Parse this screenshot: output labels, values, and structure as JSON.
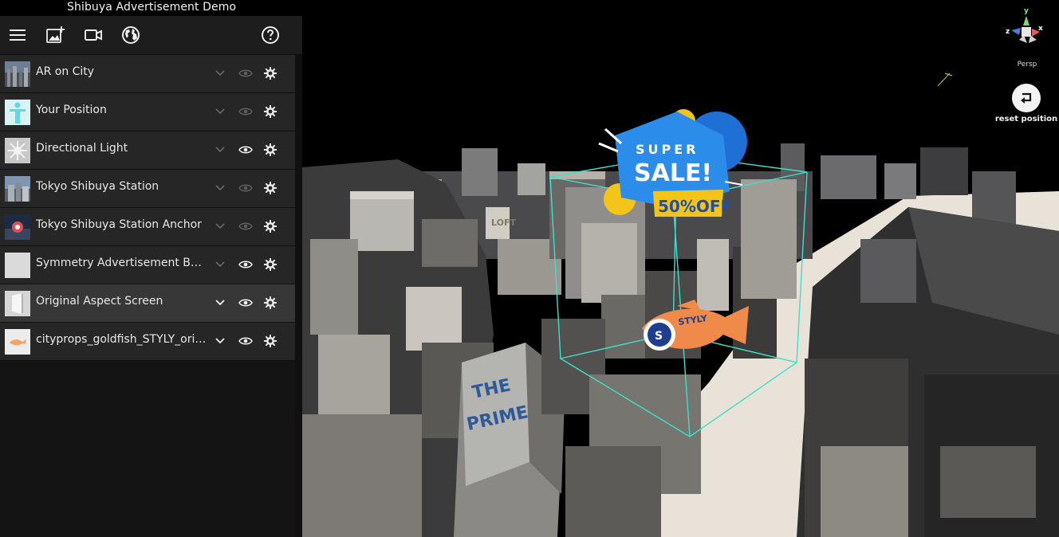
{
  "app": {
    "title": "Shibuya Advertisement Demo"
  },
  "toolbar": {
    "icons": [
      "menu-icon",
      "add-image-icon",
      "video-icon",
      "globe-icon",
      "help-icon"
    ]
  },
  "layers": [
    {
      "name": "AR on City",
      "visible": false,
      "expanded": false,
      "selected": false
    },
    {
      "name": "Your Position",
      "visible": false,
      "expanded": false,
      "selected": false
    },
    {
      "name": "Directional Light",
      "visible": true,
      "expanded": false,
      "selected": false
    },
    {
      "name": "Tokyo Shibuya Station",
      "visible": false,
      "expanded": false,
      "selected": false
    },
    {
      "name": "Tokyo Shibuya Station Anchor",
      "visible": false,
      "expanded": false,
      "selected": false
    },
    {
      "name": "Symmetry Advertisement Boundary",
      "visible": true,
      "expanded": false,
      "selected": false
    },
    {
      "name": "Original Aspect Screen",
      "visible": true,
      "expanded": true,
      "selected": true
    },
    {
      "name": "cityprops_goldfish_STYLY_original",
      "visible": true,
      "expanded": true,
      "selected": false
    }
  ],
  "viewport": {
    "gizmo": {
      "axis_y": "y",
      "axis_z": "z",
      "axis_x": "x",
      "projection": "Persp"
    },
    "reset_label": "reset position",
    "billboard": {
      "line1": "SUPER",
      "line2": "SALE!",
      "line3": "50%OFF"
    },
    "goldfish_logo": "STYLY",
    "building_sign_1": "THE",
    "building_sign_2": "PRIME",
    "loft_sign": "LOFT",
    "colors": {
      "selection_box": "#3de0c8",
      "billboard_blue": "#1e6fd6",
      "billboard_yellow": "#f5c418",
      "ground": "#ece6dc"
    }
  }
}
